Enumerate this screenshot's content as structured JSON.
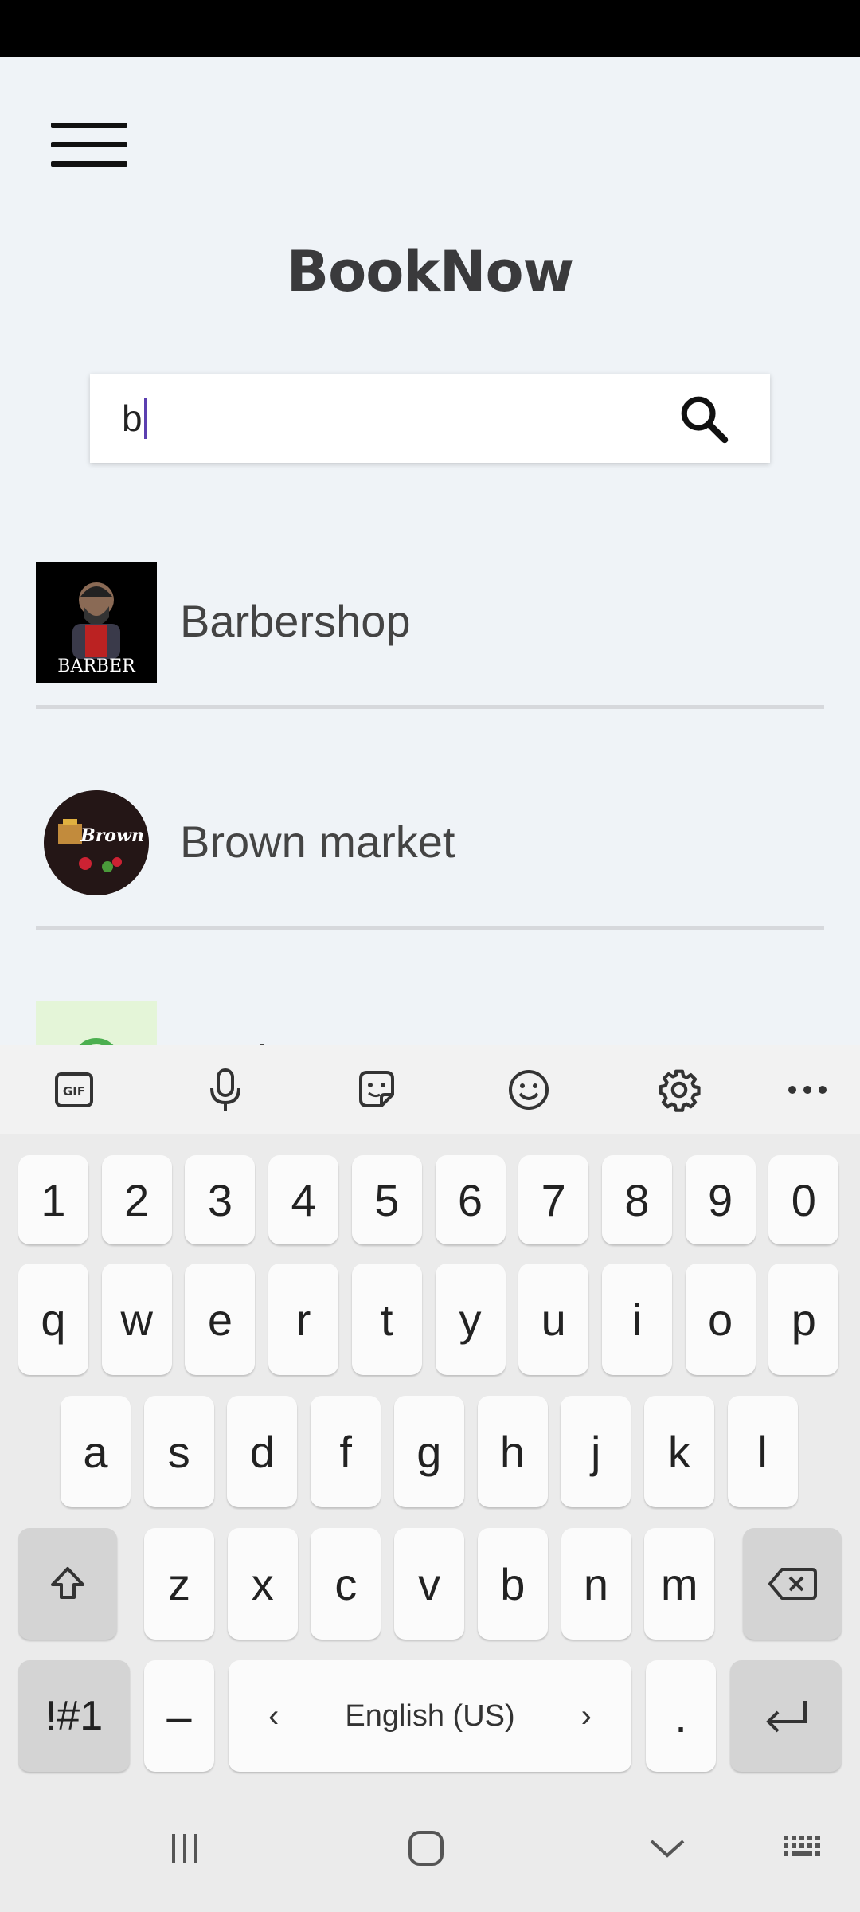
{
  "header": {
    "menu_icon": "hamburger-menu-icon",
    "title": "BookNow"
  },
  "search": {
    "value": "b",
    "icon": "search-icon"
  },
  "results": [
    {
      "label": "Barbershop",
      "logo_text": "BARBER"
    },
    {
      "label": "Brown market",
      "logo_text": "Brown"
    },
    {
      "label": "Basic"
    }
  ],
  "keyboard": {
    "toolbar": [
      "gif-icon",
      "microphone-icon",
      "sticker-icon",
      "emoji-icon",
      "settings-icon",
      "more-icon"
    ],
    "gif_label": "GIF",
    "row_numbers": [
      "1",
      "2",
      "3",
      "4",
      "5",
      "6",
      "7",
      "8",
      "9",
      "0"
    ],
    "row1": [
      "q",
      "w",
      "e",
      "r",
      "t",
      "y",
      "u",
      "i",
      "o",
      "p"
    ],
    "row2": [
      "a",
      "s",
      "d",
      "f",
      "g",
      "h",
      "j",
      "k",
      "l"
    ],
    "row3": [
      "z",
      "x",
      "c",
      "v",
      "b",
      "n",
      "m"
    ],
    "symbols_label": "!#1",
    "dash_label": "–",
    "space_label": "English (US)",
    "period_label": "."
  },
  "colors": {
    "background": "#eff3f7",
    "caret": "#5b3fb0",
    "title": "#3a3a3c"
  }
}
